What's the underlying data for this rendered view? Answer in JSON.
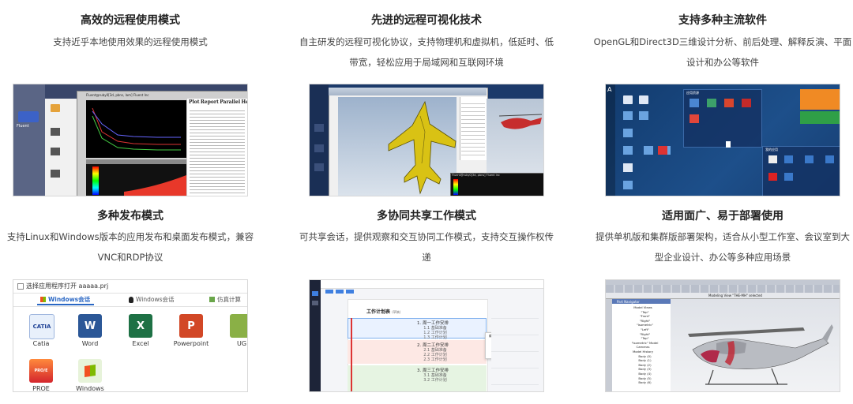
{
  "features": [
    {
      "title": "高效的远程使用模式",
      "desc": "支持近乎本地使用效果的远程使用模式"
    },
    {
      "title": "先进的远程可视化技术",
      "desc": "自主研发的远程可视化协议，支持物理机和虚拟机，低延时、低带宽，轻松应用于局域网和互联网环境"
    },
    {
      "title": "支持多种主流软件",
      "desc": "OpenGL和Direct3D三维设计分析、前后处理、解释反演、平面设计和办公等软件"
    },
    {
      "title": "多种发布模式",
      "desc": "支持Linux和Windows版本的应用发布和桌面发布模式，兼容VNC和RDP协议"
    },
    {
      "title": "多协同共享工作模式",
      "desc": "可共享会话，提供观察和交互协同工作模式，支持交互操作权传递"
    },
    {
      "title": "适用面广、易于部署使用",
      "desc": "提供单机版和集群版部署架构，适合从小型工作室、会议室到大型企业设计、办公等多种应用场景"
    }
  ],
  "shot1": {
    "window_title": "Fluent@ruby0[3d, pbns, lam] Fluent Inc",
    "menu": [
      "Plot",
      "Report",
      "Parallel",
      "He"
    ],
    "sidebar_label": "Fluent"
  },
  "shot2": {
    "viewer_title": "Fluent@ruby0[3d, pbns] Fluent Inc"
  },
  "shot3": {
    "panel_title": "应用资源",
    "panel2_title": "我的应用"
  },
  "shot4": {
    "dialog_title": "选择应用程序打开 aaaaa.prj",
    "tabs": [
      "Windows会话",
      "Windows会话",
      "仿真计算"
    ],
    "apps": [
      {
        "label": "Catia",
        "text": "CATIA",
        "color": "#e8f0fb"
      },
      {
        "label": "Word",
        "text": "W",
        "color": "#2b5797"
      },
      {
        "label": "Excel",
        "text": "X",
        "color": "#1e7145"
      },
      {
        "label": "Powerpoint",
        "text": "P",
        "color": "#d24726"
      },
      {
        "label": "UG",
        "text": "",
        "color": "#8ab046"
      },
      {
        "label": "PROE",
        "text": "PRO/E",
        "color": "#d4252d"
      },
      {
        "label": "Windows",
        "text": "",
        "color": "#e7f3da"
      }
    ]
  },
  "shot5": {
    "heading": "工作计划表",
    "tag": "(草稿)",
    "groups": [
      {
        "title": "1. 周一工作安排",
        "items": [
          "1.1 基础准备",
          "1.2 工作计划",
          "1.3 工作计划"
        ]
      },
      {
        "title": "2. 周二工作安排",
        "items": [
          "2.1 基础准备",
          "2.2 工作计划",
          "2.3 工作计划"
        ]
      },
      {
        "title": "3. 周三工作安排",
        "items": [
          "3.1 基础准备",
          "3.2 工作计划"
        ]
      }
    ],
    "menu_items": [
      "编辑操作",
      "添加",
      "复制",
      "删除",
      "上移"
    ]
  },
  "shot6": {
    "model_title": "Modeling View \"THE-MH\" selected",
    "tree_title": "Part Navigator",
    "tree_items": [
      "Model Views",
      "\"Top\"",
      "\"Front\"",
      "\"Right\"",
      "\"Isometric\"",
      "\"Left\"",
      "\"Right\"",
      "\"Top\"",
      "\"Isometric\" Model",
      "Cameras",
      "Model History",
      "Body (0)",
      "Body (1)",
      "Body (2)",
      "Body (3)",
      "Body (4)",
      "Body (5)",
      "Body (6)"
    ]
  }
}
